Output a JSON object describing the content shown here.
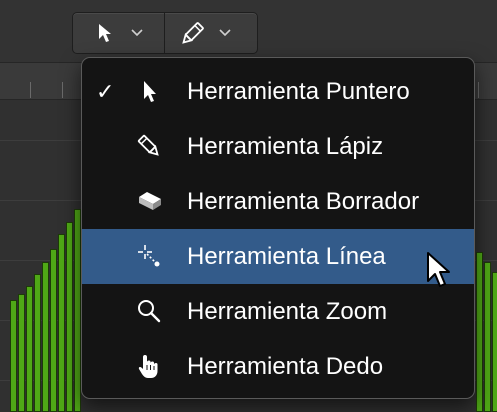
{
  "toolbar": {
    "left_tool_icon": "pointer-arrow-icon",
    "right_tool_icon": "pencil-icon"
  },
  "menu": {
    "items": [
      {
        "label": "Herramienta Puntero",
        "icon": "pointer-arrow-icon",
        "checked": true,
        "check_mark": "✓",
        "highlighted": false
      },
      {
        "label": "Herramienta Lápiz",
        "icon": "pencil-icon",
        "checked": false,
        "highlighted": false
      },
      {
        "label": "Herramienta Borrador",
        "icon": "eraser-icon",
        "checked": false,
        "highlighted": false
      },
      {
        "label": "Herramienta Línea",
        "icon": "line-crosshair-icon",
        "checked": false,
        "highlighted": true
      },
      {
        "label": "Herramienta Zoom",
        "icon": "magnifier-icon",
        "checked": false,
        "highlighted": false
      },
      {
        "label": "Herramienta Dedo",
        "icon": "finger-hand-icon",
        "checked": false,
        "highlighted": false
      }
    ]
  },
  "colors": {
    "bar_fill": "#4fa816",
    "menu_highlight": "#335b8a",
    "menu_background": "#141414"
  }
}
